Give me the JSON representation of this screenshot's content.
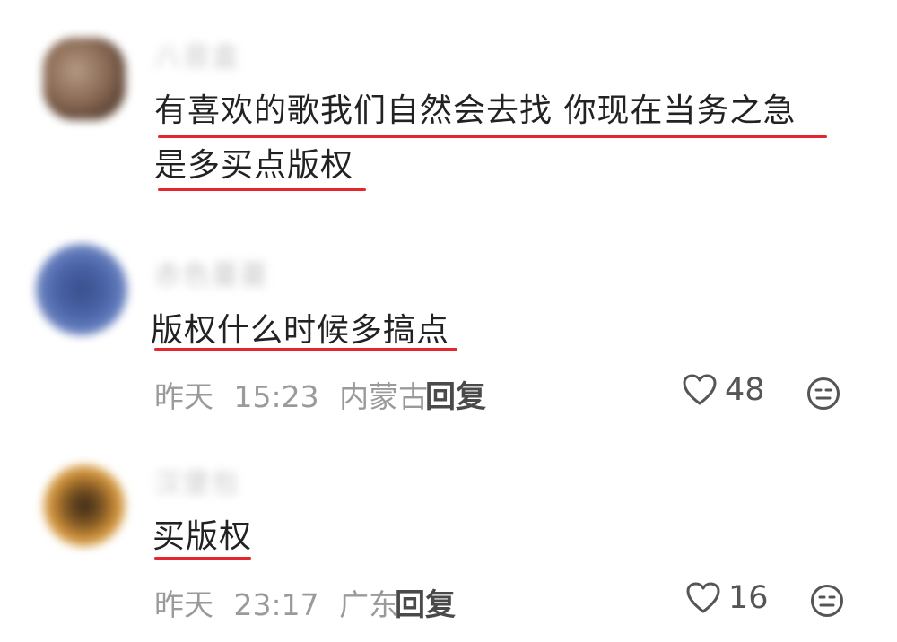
{
  "comments": [
    {
      "username": "八音盒",
      "text_line1": "有喜欢的歌我们自然会去找  你现在当务之急",
      "text_line2": "是多买点版权"
    },
    {
      "username": "赤色蔓蔓",
      "text_line1": "版权什么时候多搞点",
      "date": "昨天",
      "time": "15:23",
      "location": "内蒙古",
      "reply_label": "回复",
      "likes": "48"
    },
    {
      "username": "汉堡包",
      "text_line1": "买版权",
      "date": "昨天",
      "time": "23:17",
      "location": "广东",
      "reply_label": "回复",
      "likes": "16"
    }
  ],
  "icons": {
    "like": "heart-outline-icon",
    "dislike": "neutral-face-icon"
  },
  "colors": {
    "underline": "#e5262f",
    "meta_text": "#9a9a9a"
  }
}
